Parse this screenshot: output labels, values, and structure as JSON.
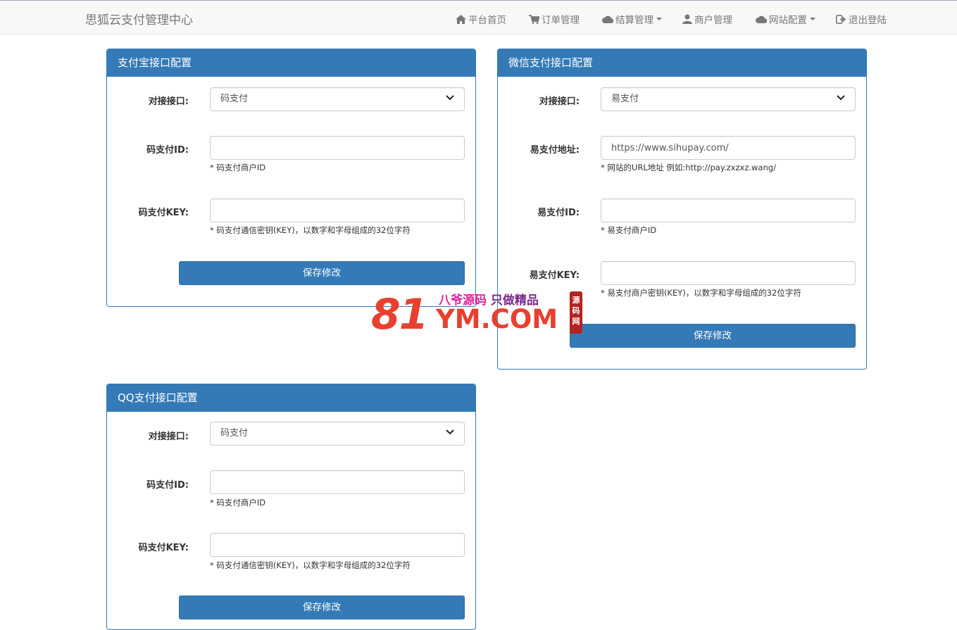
{
  "brand": "思狐云支付管理中心",
  "nav": [
    {
      "label": "平台首页",
      "icon": "home-icon"
    },
    {
      "label": "订单管理",
      "icon": "cart-icon"
    },
    {
      "label": "结算管理",
      "icon": "cloud-icon",
      "dropdown": true
    },
    {
      "label": "商户管理",
      "icon": "user-icon"
    },
    {
      "label": "网站配置",
      "icon": "cloud-icon",
      "dropdown": true
    },
    {
      "label": "退出登陆",
      "icon": "logout-icon"
    }
  ],
  "alipay": {
    "title": "支付宝接口配置",
    "interface_label": "对接接口:",
    "interface_value": "码支付",
    "id_label": "码支付ID:",
    "id_value": "",
    "id_help": "* 码支付商户ID",
    "key_label": "码支付KEY:",
    "key_value": "",
    "key_help": "* 码支付通信密钥(KEY)，以数字和字母组成的32位字符",
    "save": "保存修改"
  },
  "wechat": {
    "title": "微信支付接口配置",
    "interface_label": "对接接口:",
    "interface_value": "易支付",
    "url_label": "易支付地址:",
    "url_value": "https://www.sihupay.com/",
    "url_help": "* 网站的URL地址 例如:http://pay.zxzxz.wang/",
    "id_label": "易支付ID:",
    "id_value": "",
    "id_help": "* 易支付商户ID",
    "key_label": "易支付KEY:",
    "key_value": "",
    "key_help": "* 易支付商户密钥(KEY)，以数字和字母组成的32位字符",
    "save": "保存修改"
  },
  "qq": {
    "title": "QQ支付接口配置",
    "interface_label": "对接接口:",
    "interface_value": "码支付",
    "id_label": "码支付ID:",
    "id_value": "",
    "id_help": "* 码支付商户ID",
    "key_label": "码支付KEY:",
    "key_value": "",
    "key_help": "* 码支付通信密钥(KEY)，以数字和字母组成的32位字符",
    "save": "保存修改"
  },
  "watermark": {
    "big": "81",
    "com": "YM.COM",
    "slogan_a": "八爷源码",
    "slogan_b": " 只做精品",
    "seal": "源码网"
  },
  "colors": {
    "primary": "#337ab7",
    "watermark": "#e8402f"
  }
}
